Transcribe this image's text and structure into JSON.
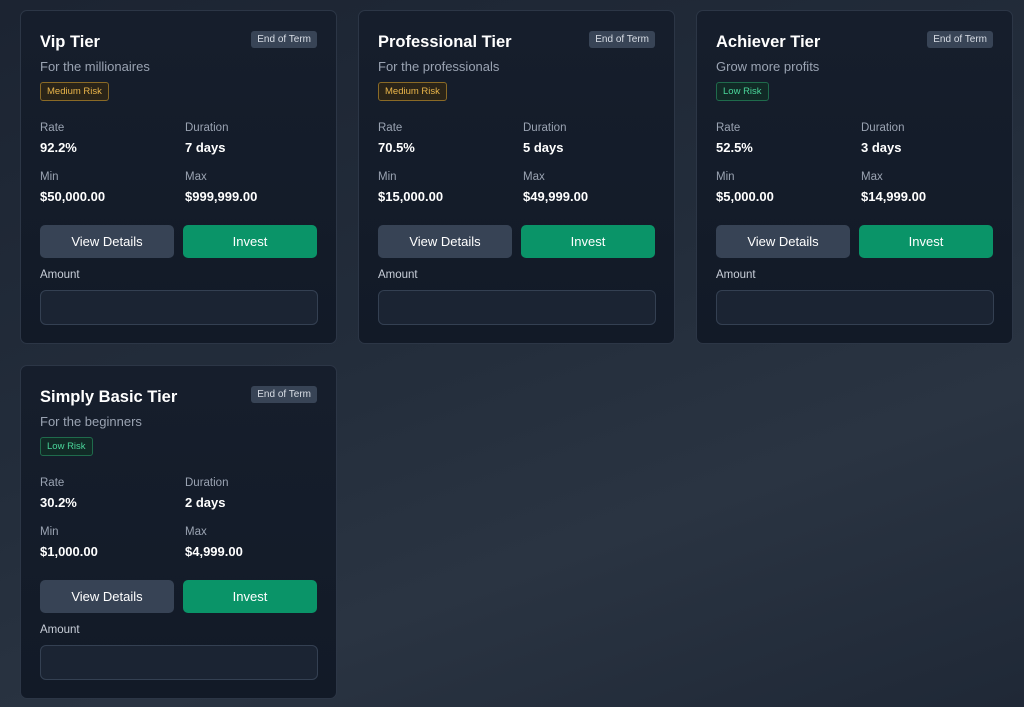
{
  "tiers": [
    {
      "title": "Vip Tier",
      "subtitle": "For the millionaires",
      "term_badge": "End of Term",
      "risk": "Medium Risk",
      "risk_level": "medium",
      "rate_label": "Rate",
      "rate": "92.2%",
      "duration_label": "Duration",
      "duration": "7 days",
      "min_label": "Min",
      "min": "$50,000.00",
      "max_label": "Max",
      "max": "$999,999.00",
      "details_label": "View Details",
      "invest_label": "Invest",
      "amount_label": "Amount",
      "amount_value": ""
    },
    {
      "title": "Professional Tier",
      "subtitle": "For the professionals",
      "term_badge": "End of Term",
      "risk": "Medium Risk",
      "risk_level": "medium",
      "rate_label": "Rate",
      "rate": "70.5%",
      "duration_label": "Duration",
      "duration": "5 days",
      "min_label": "Min",
      "min": "$15,000.00",
      "max_label": "Max",
      "max": "$49,999.00",
      "details_label": "View Details",
      "invest_label": "Invest",
      "amount_label": "Amount",
      "amount_value": ""
    },
    {
      "title": "Achiever Tier",
      "subtitle": "Grow more profits",
      "term_badge": "End of Term",
      "risk": "Low Risk",
      "risk_level": "low",
      "rate_label": "Rate",
      "rate": "52.5%",
      "duration_label": "Duration",
      "duration": "3 days",
      "min_label": "Min",
      "min": "$5,000.00",
      "max_label": "Max",
      "max": "$14,999.00",
      "details_label": "View Details",
      "invest_label": "Invest",
      "amount_label": "Amount",
      "amount_value": ""
    },
    {
      "title": "Simply Basic Tier",
      "subtitle": "For the beginners",
      "term_badge": "End of Term",
      "risk": "Low Risk",
      "risk_level": "low",
      "rate_label": "Rate",
      "rate": "30.2%",
      "duration_label": "Duration",
      "duration": "2 days",
      "min_label": "Min",
      "min": "$1,000.00",
      "max_label": "Max",
      "max": "$4,999.00",
      "details_label": "View Details",
      "invest_label": "Invest",
      "amount_label": "Amount",
      "amount_value": ""
    }
  ],
  "colors": {
    "accent_invest": "#0a9468",
    "risk_medium": "#eab54a",
    "risk_low": "#4ad69a"
  }
}
